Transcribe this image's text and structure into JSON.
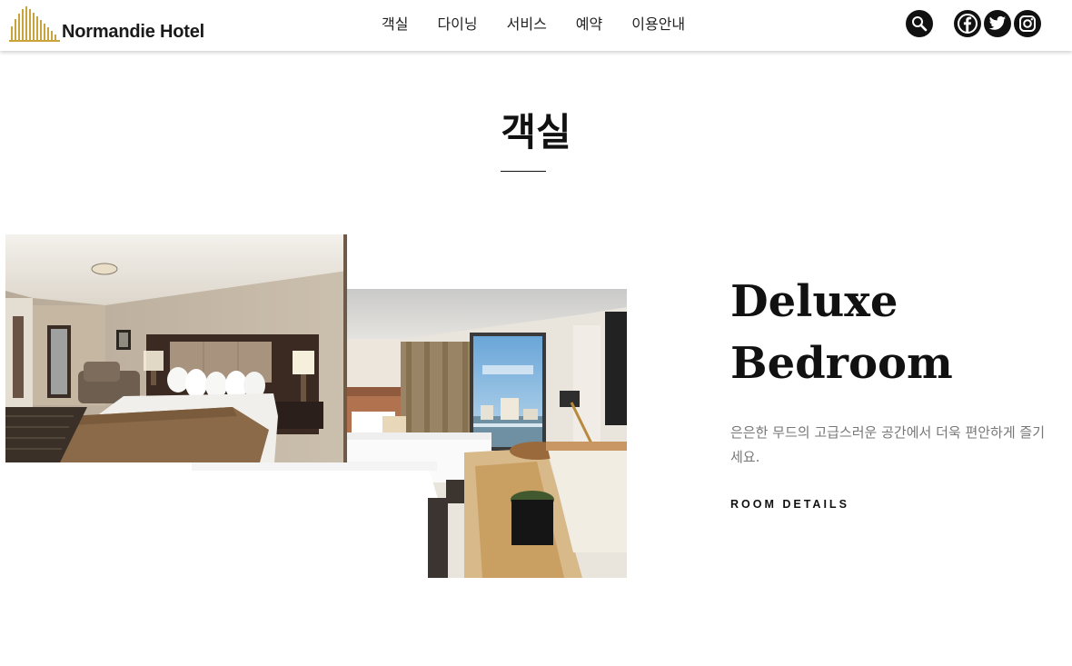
{
  "brand": {
    "name": "Normandie Hotel",
    "accent": "#c9a43a"
  },
  "nav": {
    "items": [
      "객실",
      "다이닝",
      "서비스",
      "예약",
      "이용안내"
    ]
  },
  "header_icons": [
    "search-icon",
    "facebook-icon",
    "twitter-icon",
    "instagram-icon"
  ],
  "section": {
    "title": "객실"
  },
  "room": {
    "name_line1": "Deluxe",
    "name_line2": "Bedroom",
    "description": "은은한 무드의 고급스러운 공간에서 더욱 편안하게 즐기세요.",
    "details_link": "ROOM DETAILS"
  },
  "photos": [
    "hotel-room-photo-king-bed",
    "hotel-room-photo-double-beds"
  ]
}
